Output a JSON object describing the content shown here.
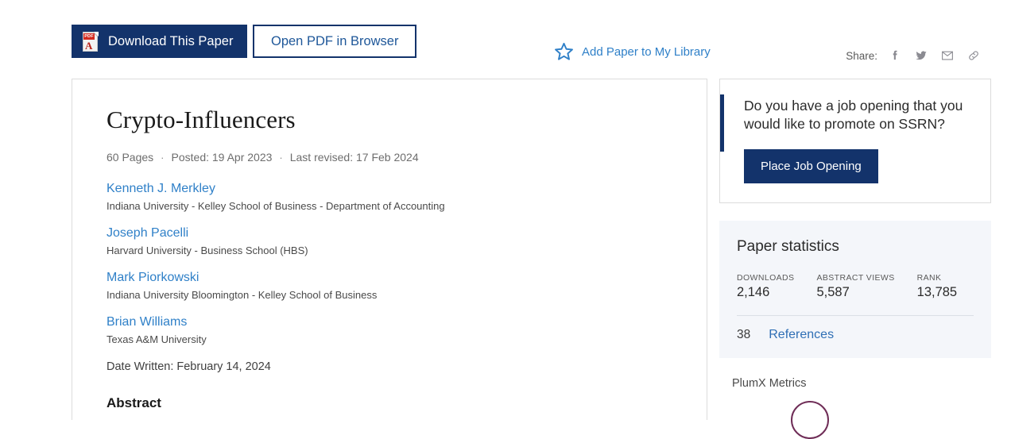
{
  "actions": {
    "download_label": "Download This Paper",
    "download_icon": "pdf-file-icon",
    "pdf_badge": "PDF",
    "pdf_glyph": "A",
    "open_pdf_label": "Open PDF in Browser",
    "add_library_label": "Add Paper to My Library",
    "add_library_icon": "star-outline-icon",
    "share_label": "Share:",
    "share_icons": [
      "facebook-icon",
      "twitter-icon",
      "email-icon",
      "link-icon"
    ]
  },
  "paper": {
    "title": "Crypto-Influencers",
    "pages": "60 Pages",
    "separator": "·",
    "posted": "Posted: 19 Apr 2023",
    "last_revised": "Last revised: 17 Feb 2024",
    "authors": [
      {
        "name": "Kenneth J. Merkley",
        "affiliation": "Indiana University - Kelley School of Business - Department of Accounting"
      },
      {
        "name": "Joseph Pacelli",
        "affiliation": "Harvard University - Business School (HBS)"
      },
      {
        "name": "Mark Piorkowski",
        "affiliation": "Indiana University Bloomington - Kelley School of Business"
      },
      {
        "name": "Brian Williams",
        "affiliation": "Texas A&M University"
      }
    ],
    "date_written": "Date Written: February 14, 2024",
    "abstract_heading": "Abstract"
  },
  "promo": {
    "text": "Do you have a job opening that you would like to promote on SSRN?",
    "button_label": "Place Job Opening"
  },
  "statistics": {
    "title": "Paper statistics",
    "items": [
      {
        "label": "DOWNLOADS",
        "value": "2,146"
      },
      {
        "label": "ABSTRACT VIEWS",
        "value": "5,587"
      },
      {
        "label": "RANK",
        "value": "13,785"
      }
    ],
    "references_count": "38",
    "references_label": "References"
  },
  "plumx": {
    "title": "PlumX Metrics"
  },
  "colors": {
    "brand_navy": "#13336b",
    "link_blue": "#2f80c8",
    "panel_bg": "#f4f6fa",
    "pdf_red": "#d32b20"
  }
}
